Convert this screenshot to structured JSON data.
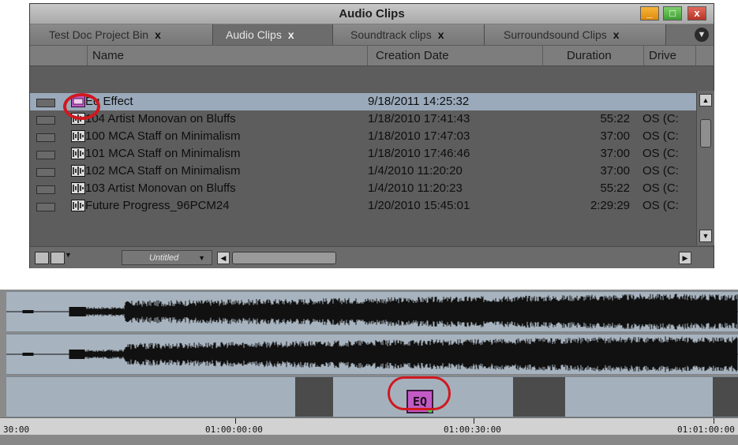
{
  "bin_window": {
    "title": "Audio Clips",
    "controls": {
      "minimize": "_",
      "maximize": "□",
      "close": "x"
    },
    "tabs": [
      {
        "label": "Test Doc Project Bin",
        "close": "x",
        "active": false
      },
      {
        "label": "Audio Clips",
        "close": "x",
        "active": true
      },
      {
        "label": "Soundtrack clips",
        "close": "x",
        "active": false
      },
      {
        "label": "Surroundsound Clips",
        "close": "x",
        "active": false
      }
    ],
    "columns": {
      "name": "Name",
      "creation_date": "Creation Date",
      "duration": "Duration",
      "drive": "Drive"
    },
    "rows": [
      {
        "icon": "effect-icon",
        "name": "Eq Effect",
        "date": "9/18/2011 14:25:32",
        "duration": "",
        "drive": "",
        "selected": true
      },
      {
        "icon": "audio-clip-icon",
        "name": "104 Artist Monovan on Bluffs",
        "date": "1/18/2010 17:41:43",
        "duration": "55:22",
        "drive": "OS (C:"
      },
      {
        "icon": "audio-clip-icon",
        "name": "100 MCA Staff on Minimalism",
        "date": "1/18/2010 17:47:03",
        "duration": "37:00",
        "drive": "OS (C:"
      },
      {
        "icon": "audio-clip-icon",
        "name": "101 MCA Staff on Minimalism",
        "date": "1/18/2010 17:46:46",
        "duration": "37:00",
        "drive": "OS (C:"
      },
      {
        "icon": "audio-clip-icon",
        "name": "102 MCA Staff on Minimalism",
        "date": "1/4/2010 11:20:20",
        "duration": "37:00",
        "drive": "OS (C:"
      },
      {
        "icon": "audio-clip-icon",
        "name": "103 Artist Monovan on Bluffs",
        "date": "1/4/2010 11:20:23",
        "duration": "55:22",
        "drive": "OS (C:"
      },
      {
        "icon": "audio-clip-icon",
        "name": "Future Progress_96PCM24",
        "date": "1/20/2010 15:45:01",
        "duration": "2:29:29",
        "drive": "OS (C:"
      }
    ],
    "footer": {
      "view_setting": "Untitled"
    }
  },
  "timeline": {
    "effect_label": "EQ",
    "timecodes": [
      "30:00",
      "01:00:00:00",
      "01:00:30:00",
      "01:01:00:00"
    ]
  },
  "colors": {
    "highlight_circle": "#d01820",
    "effect_icon": "#c35bc6",
    "selected_row": "#9aaabb",
    "track": "#a7b3be"
  }
}
